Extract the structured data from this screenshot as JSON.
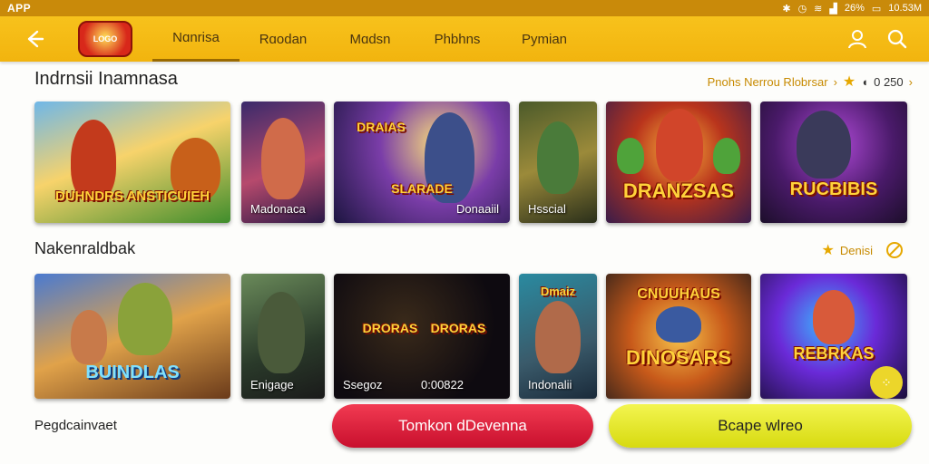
{
  "status_bar": {
    "app_label": "APP",
    "battery": "26%",
    "time": "10.53M"
  },
  "header": {
    "tabs": [
      "Nɑnrisa",
      "Rɑodan",
      "Mɑdsn",
      "Phbhns",
      "Pymian"
    ],
    "active_tab": 0,
    "logo_text": "LOGO"
  },
  "section1": {
    "title": "Indrnsii Inamnasa",
    "link": "Pnohs Nerrou Rlobrsar",
    "rating": "0 250",
    "cards": [
      {
        "title": "DUHNDRS ANSTICUIEH",
        "caption": ""
      },
      {
        "title": "",
        "caption": "Madonaca"
      },
      {
        "title": "SLARADE",
        "caption": "Donaaiil"
      },
      {
        "title": "",
        "caption": "Hsscial"
      },
      {
        "title": "DRANZSAS",
        "caption": ""
      },
      {
        "title": "RUCBIBIS",
        "caption": ""
      }
    ]
  },
  "section2": {
    "title": "Nakenraldbak",
    "link": "Denisi",
    "cards": [
      {
        "title": "BUINDLAS",
        "caption": ""
      },
      {
        "title": "",
        "caption": "Enigage"
      },
      {
        "title": "DRORAS",
        "caption": "Ssegoz"
      },
      {
        "title": "Dmaiz",
        "caption": "Indonalii"
      },
      {
        "title": "DINOSARS",
        "caption": ""
      },
      {
        "title": "REBRKAS",
        "caption": ""
      }
    ],
    "extra_caption": "0:00822"
  },
  "footer": {
    "label": "Pegdcainvaet",
    "button_red": "Tomkon dDevenna",
    "button_yellow": "Bcape wlreo"
  },
  "colors": {
    "header": "#f2b40e",
    "accent": "#e6a800",
    "red": "#e0233f",
    "yellow": "#e8ea2a"
  }
}
